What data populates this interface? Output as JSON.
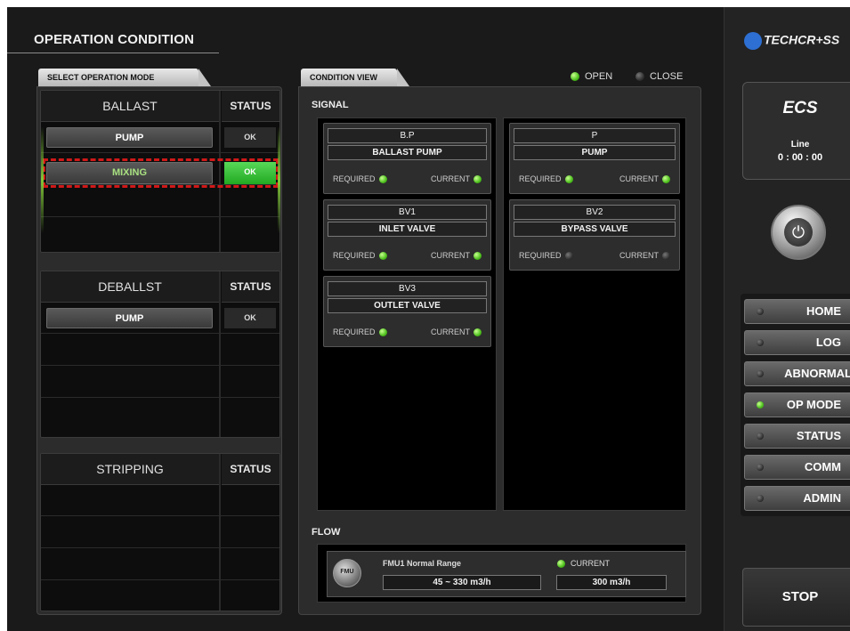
{
  "page_title": "OPERATION CONDITION",
  "brand": {
    "logo": "TECHCR+SS"
  },
  "select_mode": {
    "tab_label": "SELECT OPERATION MODE",
    "status_label": "STATUS",
    "ballast": {
      "title": "BALLAST",
      "rows": [
        {
          "label": "PUMP",
          "status": "OK"
        },
        {
          "label": "MIXING",
          "status": "OK"
        }
      ]
    },
    "deballast": {
      "title": "DEBALLST",
      "rows": [
        {
          "label": "PUMP",
          "status": "OK"
        }
      ]
    },
    "stripping": {
      "title": "STRIPPING"
    }
  },
  "condition_view": {
    "tab_label": "CONDITION VIEW",
    "legend": {
      "open": "OPEN",
      "close": "CLOSE"
    },
    "signal_label": "SIGNAL",
    "required_label": "REQUIRED",
    "current_label": "CURRENT",
    "cards": [
      {
        "code": "B.P",
        "name": "BALLAST PUMP",
        "required": "on",
        "current": "on"
      },
      {
        "code": "P",
        "name": "PUMP",
        "required": "on",
        "current": "on"
      },
      {
        "code": "BV1",
        "name": "INLET VALVE",
        "required": "on",
        "current": "on"
      },
      {
        "code": "BV2",
        "name": "BYPASS VALVE",
        "required": "off",
        "current": "off"
      },
      {
        "code": "BV3",
        "name": "OUTLET VALVE",
        "required": "on",
        "current": "on"
      }
    ],
    "flow": {
      "label": "FLOW",
      "meter_icon_text": "FMU",
      "range_label": "FMU1 Normal Range",
      "range_value": "45 ~ 330 m3/h",
      "current_label": "CURRENT",
      "current_value": "300 m3/h"
    }
  },
  "sidebar": {
    "ecs_logo": "ECS",
    "line_label": "Line",
    "timer": "0 : 00 : 00",
    "nav": [
      {
        "label": "HOME",
        "active": false
      },
      {
        "label": "LOG",
        "active": false
      },
      {
        "label": "ABNORMAL",
        "active": false
      },
      {
        "label": "OP MODE",
        "active": true
      },
      {
        "label": "STATUS",
        "active": false
      },
      {
        "label": "COMM",
        "active": false
      },
      {
        "label": "ADMIN",
        "active": false
      }
    ],
    "stop_label": "STOP"
  },
  "colors": {
    "led_on": "#4cbf1c",
    "led_off": "#333333",
    "highlight": "#d01818"
  }
}
